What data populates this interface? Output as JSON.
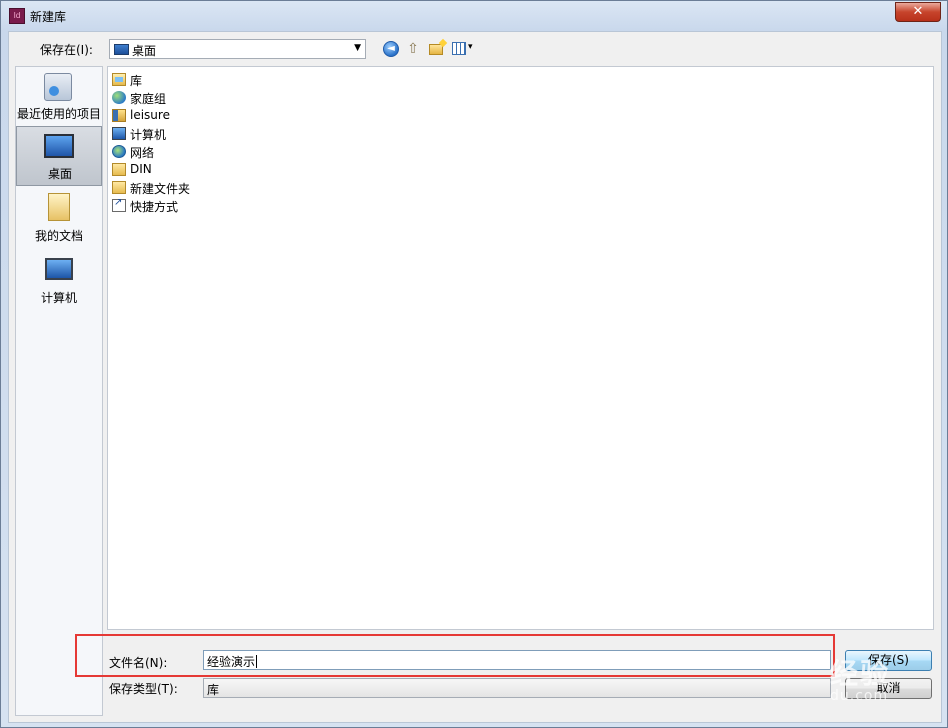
{
  "window": {
    "title": "新建库",
    "app_icon_text": "Id",
    "close_label": "✕"
  },
  "toolbar": {
    "save_in_label": "保存在(I):",
    "location": "桌面",
    "dropdown_arrow": "▼",
    "back_glyph": "◄",
    "up_glyph": "⇧",
    "views_arrow": "▾"
  },
  "places": [
    {
      "label": "最近使用的项目",
      "icon": "recent-items-icon"
    },
    {
      "label": "桌面",
      "icon": "desktop-icon",
      "selected": true
    },
    {
      "label": "我的文档",
      "icon": "documents-icon"
    },
    {
      "label": "计算机",
      "icon": "computer-icon"
    }
  ],
  "files": [
    {
      "name": "库",
      "icon": "library-icon"
    },
    {
      "name": "家庭组",
      "icon": "homegroup-icon"
    },
    {
      "name": "leisure",
      "icon": "user-folder-icon"
    },
    {
      "name": "计算机",
      "icon": "computer-icon"
    },
    {
      "name": "网络",
      "icon": "network-icon"
    },
    {
      "name": "DIN",
      "icon": "folder-icon"
    },
    {
      "name": "新建文件夹",
      "icon": "folder-icon"
    },
    {
      "name": "快捷方式",
      "icon": "shortcut-icon"
    }
  ],
  "form": {
    "filename_label": "文件名(N):",
    "filename_value": "经验演示",
    "filetype_label": "保存类型(T):",
    "filetype_value": "库"
  },
  "buttons": {
    "save": "保存(S)",
    "cancel": "取消"
  },
  "watermark": {
    "line1": "经验",
    "line2": "du.com"
  },
  "colors": {
    "highlight": "#e53935"
  }
}
